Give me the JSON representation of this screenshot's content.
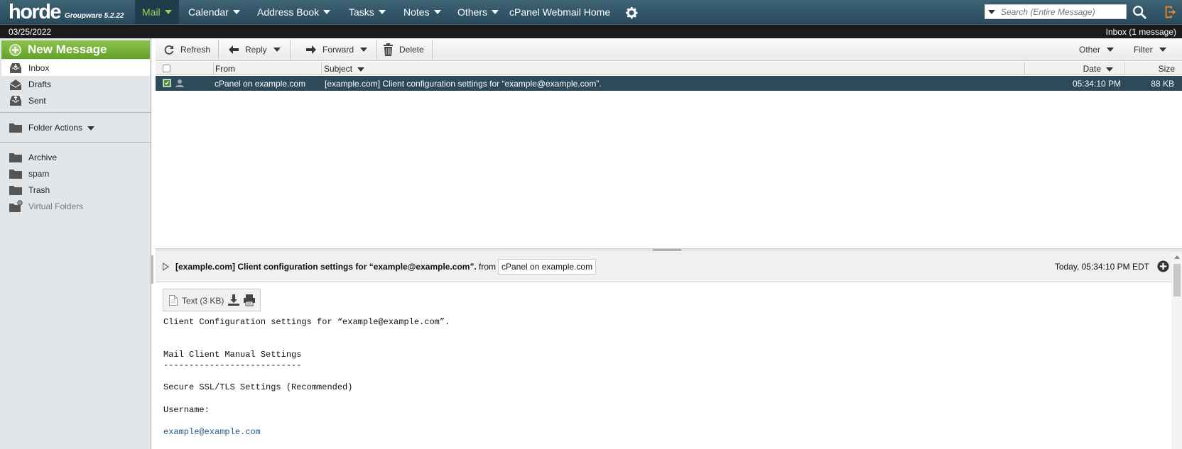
{
  "brand": {
    "name": "horde",
    "product": "Groupware 5.2.22"
  },
  "topnav": {
    "items": [
      {
        "label": "Mail",
        "active": true
      },
      {
        "label": "Calendar"
      },
      {
        "label": "Address Book"
      },
      {
        "label": "Tasks"
      },
      {
        "label": "Notes"
      },
      {
        "label": "Others"
      },
      {
        "label": "cPanel Webmail Home"
      }
    ],
    "search_placeholder": "Search (Entire Message)"
  },
  "statusbar": {
    "date": "03/25/2022",
    "folder_status": "Inbox (1 message)"
  },
  "sidebar": {
    "new_message": "New Message",
    "mailboxes": [
      {
        "label": "Inbox",
        "icon": "inbox-icon",
        "active": true
      },
      {
        "label": "Drafts",
        "icon": "drafts-icon"
      },
      {
        "label": "Sent",
        "icon": "sent-icon"
      }
    ],
    "folder_actions": "Folder Actions",
    "folders": [
      {
        "label": "Archive",
        "icon": "folder-icon"
      },
      {
        "label": "spam",
        "icon": "folder-icon"
      },
      {
        "label": "Trash",
        "icon": "folder-icon"
      },
      {
        "label": "Virtual Folders",
        "icon": "virtual-folder-icon"
      }
    ]
  },
  "toolbar": {
    "refresh": "Refresh",
    "reply": "Reply",
    "forward": "Forward",
    "delete": "Delete",
    "other": "Other",
    "filter": "Filter"
  },
  "list": {
    "columns": {
      "from": "From",
      "subject": "Subject",
      "date": "Date",
      "size": "Size"
    },
    "rows": [
      {
        "from": "cPanel on example.com",
        "subject": "[example.com] Client configuration settings for “example@example.com”.",
        "date": "05:34:10 PM",
        "size": "88 KB",
        "selected": true
      }
    ]
  },
  "preview": {
    "subject": "[example.com] Client configuration settings for “example@example.com”.",
    "from_label": "from",
    "from": "cPanel on example.com",
    "date": "Today, 05:34:10 PM EDT",
    "attachment": "Text (3 KB)",
    "body": [
      "Client Configuration settings for “example@example.com”.",
      "Mail Client Manual Settings",
      "---------------------------",
      "Secure SSL/TLS Settings (Recommended)",
      "Username:",
      "example@example.com"
    ]
  },
  "colors": {
    "accent_green": "#8ac249",
    "topbar": "#345a6b",
    "selected_row": "#2e4a58"
  }
}
